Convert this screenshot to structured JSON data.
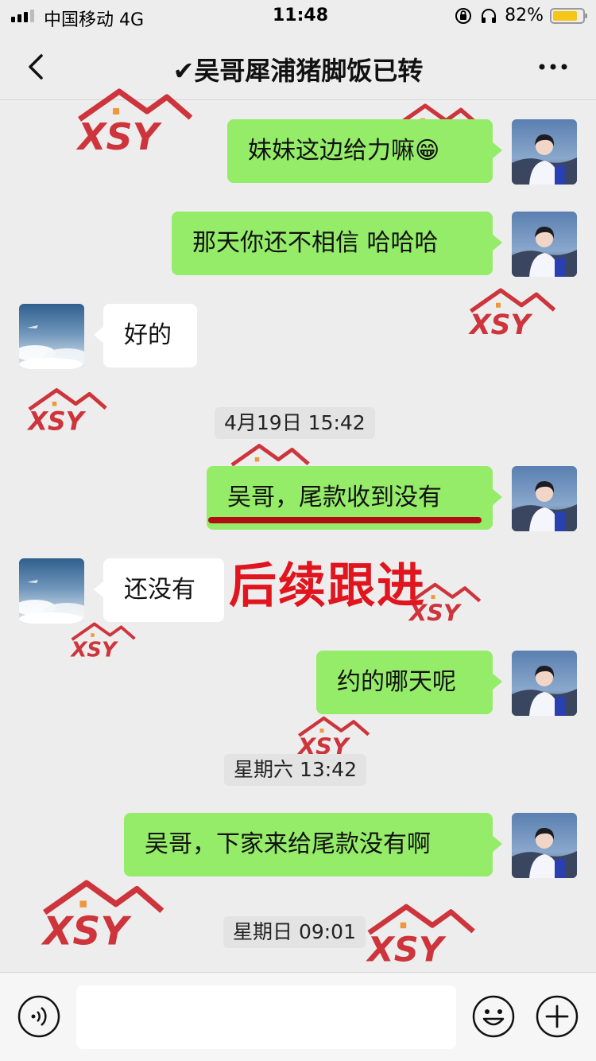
{
  "status_bar": {
    "carrier": "中国移动 4G",
    "time": "11:48",
    "battery": "82%",
    "battery_level": 0.82
  },
  "header": {
    "back_icon": "chevron-left-icon",
    "title": "✔吴哥犀浦猪脚饭已转",
    "more_icon": "ellipsis-icon"
  },
  "messages": [
    {
      "side": "me",
      "text": "妹妹这边给力嘛😁"
    },
    {
      "side": "me",
      "text": "那天你还不相信 哈哈哈"
    },
    {
      "side": "them",
      "text": "好的"
    },
    {
      "side": "time",
      "text": "4月19日 15:42"
    },
    {
      "side": "me",
      "text": "吴哥，尾款收到没有"
    },
    {
      "side": "them",
      "text": "还没有"
    },
    {
      "side": "me",
      "text": "约的哪天呢"
    },
    {
      "side": "time",
      "text": "星期六 13:42"
    },
    {
      "side": "me",
      "text": "吴哥，下家来给尾款没有啊"
    },
    {
      "side": "time",
      "text": "星期日 09:01"
    }
  ],
  "annotation": {
    "text": "后续跟进",
    "color": "#e0151e"
  },
  "input_bar": {
    "voice_icon": "voice-icon",
    "emoji_icon": "emoji-icon",
    "plus_icon": "plus-icon"
  },
  "watermark": {
    "text": "XSY",
    "icon": "house-logo-icon"
  },
  "colors": {
    "my_bubble": "#95ec69",
    "their_bubble": "#ffffff",
    "background": "#ededed"
  }
}
